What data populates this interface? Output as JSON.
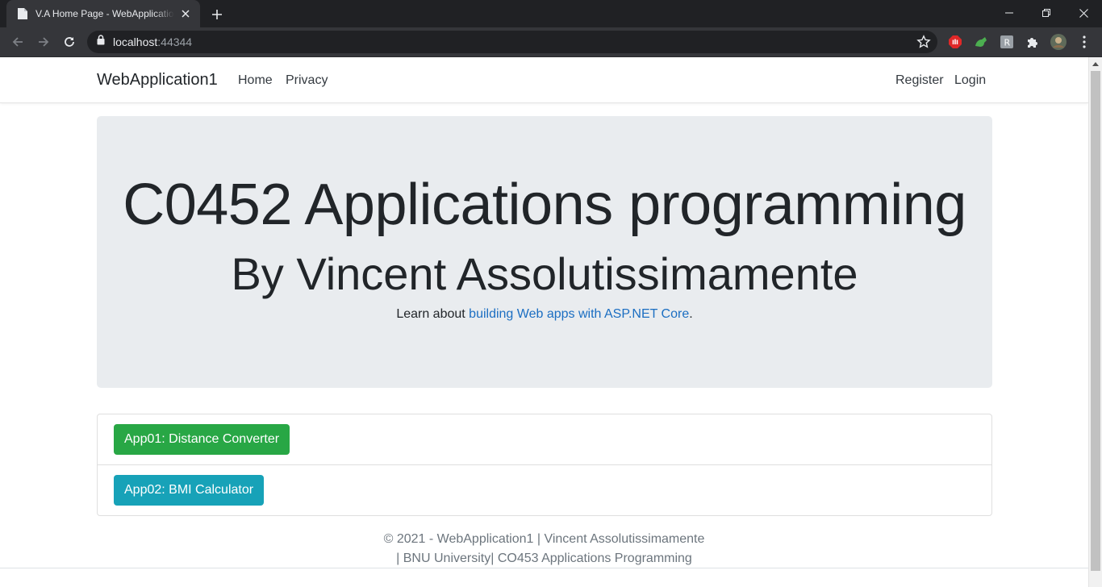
{
  "browser": {
    "tab_title": "V.A Home Page - WebApplication1",
    "url_host": "localhost",
    "url_port": ":44344"
  },
  "navbar": {
    "brand": "WebApplication1",
    "links": [
      "Home",
      "Privacy"
    ],
    "right_links": [
      "Register",
      "Login"
    ]
  },
  "hero": {
    "title": "C0452 Applications programming",
    "subtitle": "By Vincent Assolutissimamente",
    "learn_prefix": "Learn about ",
    "learn_link": "building Web apps with ASP.NET Core",
    "learn_suffix": "."
  },
  "apps": [
    {
      "label": "App01: Distance Converter",
      "color": "#28a745"
    },
    {
      "label": "App02: BMI Calculator",
      "color": "#17a2b8"
    }
  ],
  "footer": {
    "line1": "© 2021 - WebApplication1 | Vincent Assolutissimamente",
    "line2": "| BNU University| CO453 Applications Programming"
  }
}
